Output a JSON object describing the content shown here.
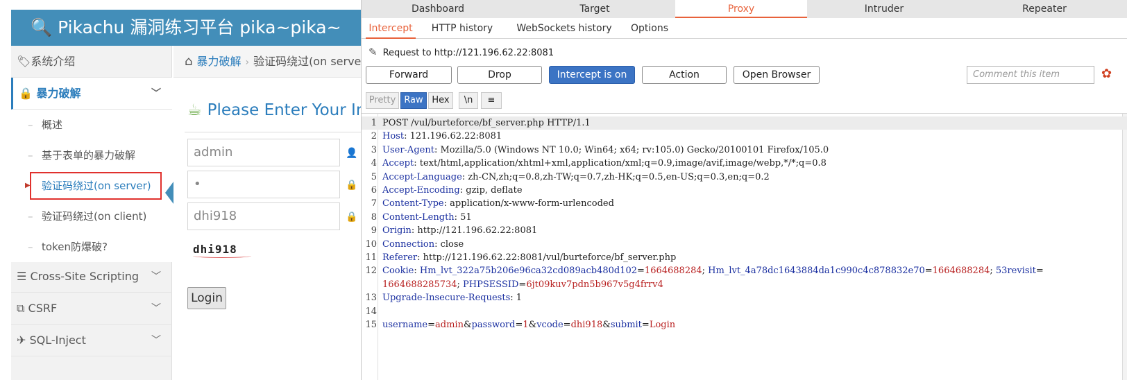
{
  "pikachu": {
    "app_title": "Pikachu 漏洞练习平台 pika~pika~",
    "sidebar": {
      "intro": "系统介绍",
      "brute_section": "暴力破解",
      "sub_items": [
        "概述",
        "基于表单的暴力破解",
        "验证码绕过(on server)",
        "验证码绕过(on client)",
        "token防爆破?"
      ],
      "xss": "Cross-Site Scripting",
      "csrf": "CSRF",
      "sqli": "SQL-Inject"
    },
    "breadcrumb": {
      "section": "暴力破解",
      "current": "验证码绕过(on server)"
    },
    "form": {
      "heading": "Please Enter Your Information",
      "username_value": "admin",
      "password_value": "•",
      "captcha_value": "dhi918",
      "captcha_image_text": "dhi918",
      "login_label": "Login"
    }
  },
  "burp": {
    "main_tabs": [
      "Dashboard",
      "Target",
      "Proxy",
      "Intruder",
      "Repeater"
    ],
    "sub_tabs": [
      "Intercept",
      "HTTP history",
      "WebSockets history",
      "Options"
    ],
    "request_to": "Request to http://121.196.62.22:8081",
    "toolbar": {
      "forward": "Forward",
      "drop": "Drop",
      "intercept": "Intercept is on",
      "action": "Action",
      "open_browser": "Open Browser",
      "comment_placeholder": "Comment this item"
    },
    "view_buttons": [
      "Pretty",
      "Raw",
      "Hex",
      "\\n",
      "≡"
    ],
    "request_lines": [
      {
        "n": "1",
        "parts": [
          [
            "v",
            "POST /vul/burteforce/bf_server.php HTTP/1.1"
          ]
        ]
      },
      {
        "n": "2",
        "parts": [
          [
            "k",
            "Host"
          ],
          [
            "v",
            ": 121.196.62.22:8081"
          ]
        ]
      },
      {
        "n": "3",
        "parts": [
          [
            "k",
            "User-Agent"
          ],
          [
            "v",
            ": Mozilla/5.0 (Windows NT 10.0; Win64; x64; rv:105.0) Gecko/20100101 Firefox/105.0"
          ]
        ]
      },
      {
        "n": "4",
        "parts": [
          [
            "k",
            "Accept"
          ],
          [
            "v",
            ": text/html,application/xhtml+xml,application/xml;q=0.9,image/avif,image/webp,*/*;q=0.8"
          ]
        ]
      },
      {
        "n": "5",
        "parts": [
          [
            "k",
            "Accept-Language"
          ],
          [
            "v",
            ": zh-CN,zh;q=0.8,zh-TW;q=0.7,zh-HK;q=0.5,en-US;q=0.3,en;q=0.2"
          ]
        ]
      },
      {
        "n": "6",
        "parts": [
          [
            "k",
            "Accept-Encoding"
          ],
          [
            "v",
            ": gzip, deflate"
          ]
        ]
      },
      {
        "n": "7",
        "parts": [
          [
            "k",
            "Content-Type"
          ],
          [
            "v",
            ": application/x-www-form-urlencoded"
          ]
        ]
      },
      {
        "n": "8",
        "parts": [
          [
            "k",
            "Content-Length"
          ],
          [
            "v",
            ": 51"
          ]
        ]
      },
      {
        "n": "9",
        "parts": [
          [
            "k",
            "Origin"
          ],
          [
            "v",
            ": http://121.196.62.22:8081"
          ]
        ]
      },
      {
        "n": "10",
        "parts": [
          [
            "k",
            "Connection"
          ],
          [
            "v",
            ": close"
          ]
        ]
      },
      {
        "n": "11",
        "parts": [
          [
            "k",
            "Referer"
          ],
          [
            "v",
            ": http://121.196.62.22:8081/vul/burteforce/bf_server.php"
          ]
        ]
      },
      {
        "n": "12",
        "parts": [
          [
            "k",
            "Cookie"
          ],
          [
            "v",
            ": "
          ],
          [
            "b",
            "Hm_lvt_322a75b206e96ca32cd089acb480d102"
          ],
          [
            "v",
            "="
          ],
          [
            "r",
            "1664688284"
          ],
          [
            "v",
            "; "
          ],
          [
            "b",
            "Hm_lvt_4a78dc1643884da1c990c4c878832e70"
          ],
          [
            "v",
            "="
          ],
          [
            "r",
            "1664688284"
          ],
          [
            "v",
            "; "
          ],
          [
            "b",
            "53revisit"
          ],
          [
            "v",
            "="
          ]
        ]
      },
      {
        "n": "",
        "parts": [
          [
            "r",
            "1664688285734"
          ],
          [
            "v",
            "; "
          ],
          [
            "b",
            "PHPSESSID"
          ],
          [
            "v",
            "="
          ],
          [
            "r",
            "6jt09kuv7pdn5b967v5g4frrv4"
          ]
        ]
      },
      {
        "n": "13",
        "parts": [
          [
            "k",
            "Upgrade-Insecure-Requests"
          ],
          [
            "v",
            ": 1"
          ]
        ]
      },
      {
        "n": "14",
        "parts": []
      },
      {
        "n": "15",
        "parts": [
          [
            "b",
            "username"
          ],
          [
            "v",
            "="
          ],
          [
            "r",
            "admin"
          ],
          [
            "v",
            "&"
          ],
          [
            "b",
            "password"
          ],
          [
            "v",
            "="
          ],
          [
            "r",
            "1"
          ],
          [
            "v",
            "&"
          ],
          [
            "b",
            "vcode"
          ],
          [
            "v",
            "="
          ],
          [
            "r",
            "dhi918"
          ],
          [
            "v",
            "&"
          ],
          [
            "b",
            "submit"
          ],
          [
            "v",
            "="
          ],
          [
            "r",
            "Login"
          ]
        ]
      }
    ]
  }
}
